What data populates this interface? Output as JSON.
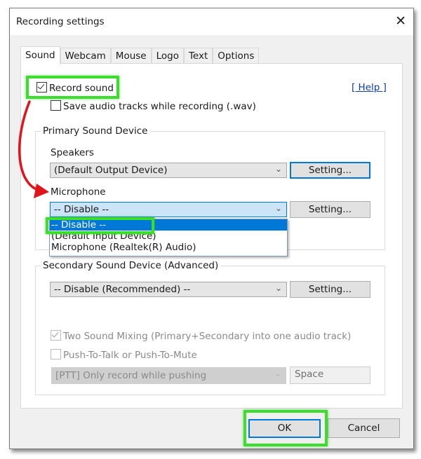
{
  "window": {
    "title": "Recording settings",
    "close_icon": "close-icon"
  },
  "tabs": [
    {
      "label": "Sound",
      "active": true
    },
    {
      "label": "Webcam",
      "active": false
    },
    {
      "label": "Mouse",
      "active": false
    },
    {
      "label": "Logo",
      "active": false
    },
    {
      "label": "Text",
      "active": false
    },
    {
      "label": "Options",
      "active": false
    }
  ],
  "sound": {
    "record_sound": {
      "label": "Record sound",
      "checked": true
    },
    "save_wav": {
      "label": "Save audio tracks while recording (.wav)",
      "checked": false
    },
    "help_link": "[ Help ]",
    "primary": {
      "legend": "Primary Sound Device",
      "speakers_label": "Speakers",
      "speakers_value": "(Default Output Device)",
      "speakers_setting": "Setting...",
      "microphone_label": "Microphone",
      "microphone_value": "-- Disable --",
      "microphone_setting": "Setting...",
      "microphone_options": [
        "-- Disable --",
        "(Default Input Device)",
        "Microphone (Realtek(R) Audio)"
      ],
      "microphone_selected_index": 0
    },
    "secondary": {
      "legend": "Secondary Sound Device (Advanced)",
      "device_value": "-- Disable (Recommended) --",
      "setting": "Setting...",
      "two_sound_mixing": {
        "label": "Two Sound Mixing (Primary+Secondary into one audio track)",
        "checked": true,
        "enabled": false
      },
      "push_to_talk": {
        "label": "Push-To-Talk or Push-To-Mute",
        "checked": false,
        "enabled": false
      },
      "ptt_mode_value": "[PTT] Only record while pushing",
      "ptt_key_value": "Space"
    }
  },
  "footer": {
    "ok_label": "OK",
    "cancel_label": "Cancel"
  },
  "annotations": {
    "highlight_color": "#3ddc2f",
    "arrow_color": "#e0141b"
  }
}
